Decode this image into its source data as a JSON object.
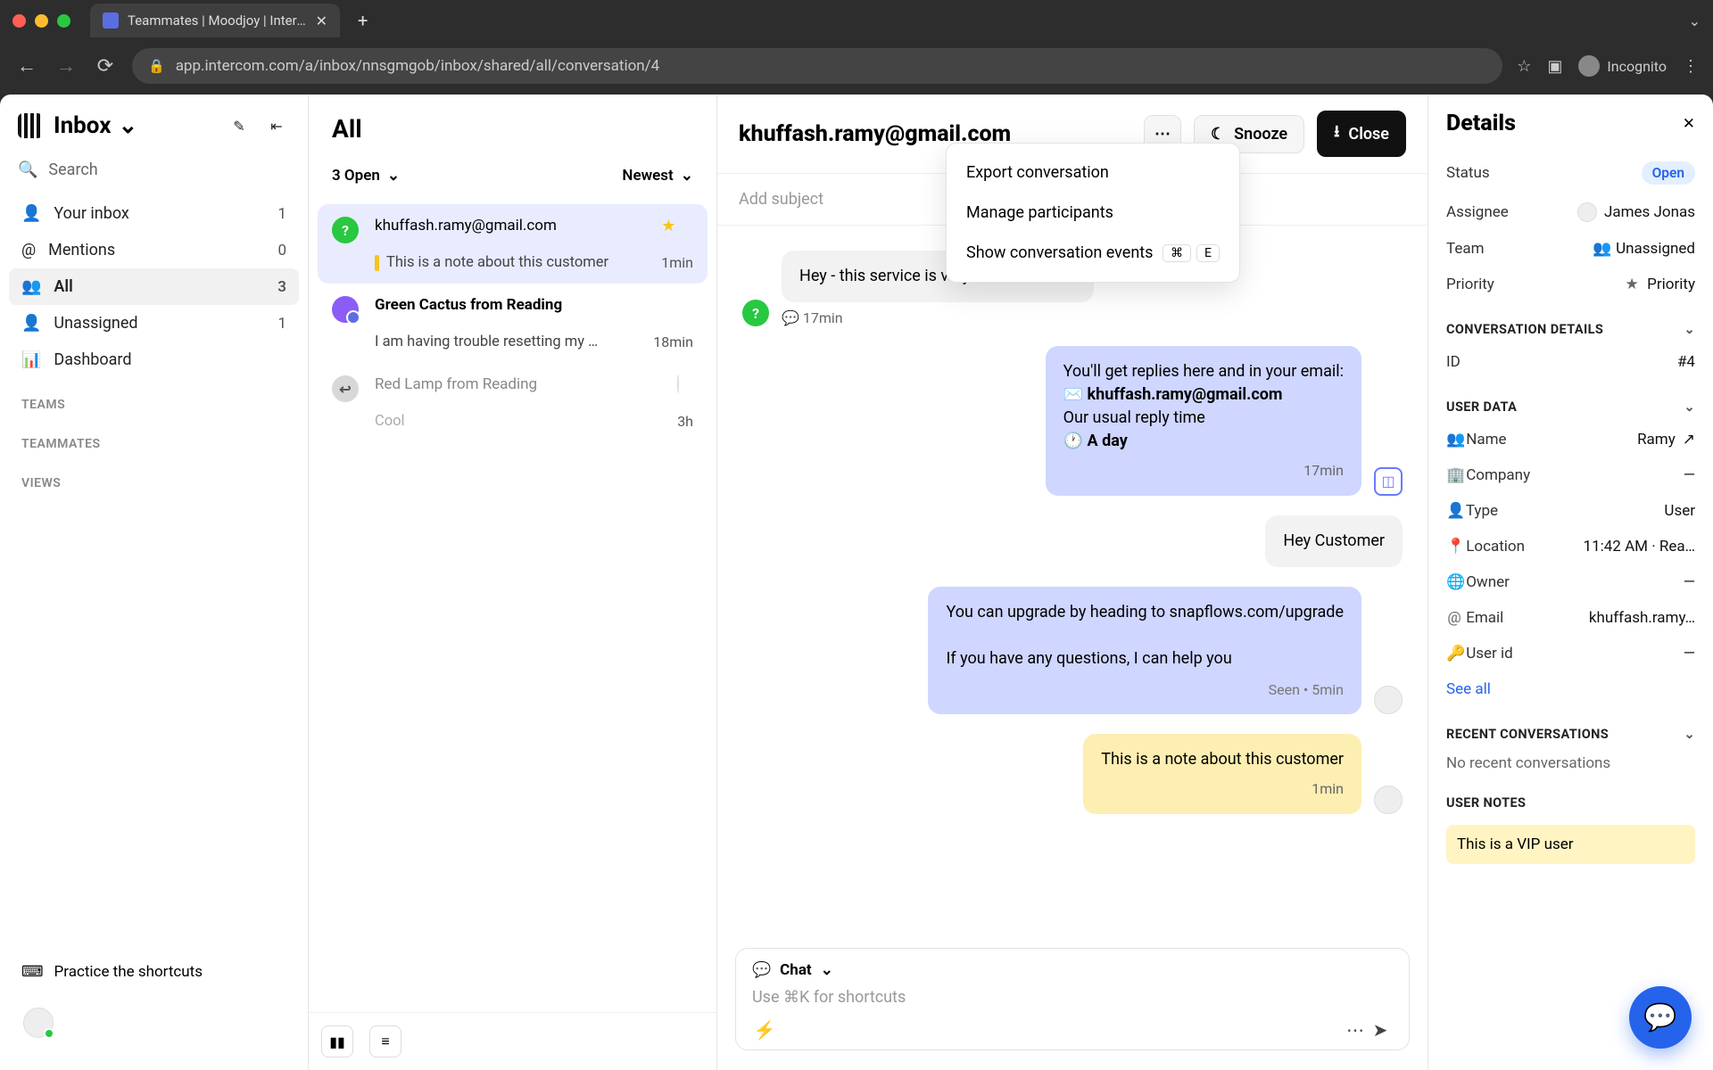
{
  "browser": {
    "tab_title": "Teammates | Moodjoy | Interco",
    "url": "app.intercom.com/a/inbox/nnsgmgob/inbox/shared/all/conversation/4",
    "incognito_label": "Incognito"
  },
  "sidebar": {
    "title": "Inbox",
    "search_label": "Search",
    "nav": [
      {
        "icon": "👤",
        "label": "Your inbox",
        "count": "1"
      },
      {
        "icon": "@",
        "label": "Mentions",
        "count": "0"
      },
      {
        "icon": "👥",
        "label": "All",
        "count": "3",
        "active": true
      },
      {
        "icon": "👤",
        "label": "Unassigned",
        "count": "1"
      },
      {
        "icon": "📊",
        "label": "Dashboard",
        "count": ""
      }
    ],
    "sections": [
      "TEAMS",
      "TEAMMATES",
      "VIEWS"
    ],
    "practice": "Practice the shortcuts"
  },
  "conv_list": {
    "title": "All",
    "open_filter": "3 Open",
    "sort": "Newest",
    "items": [
      {
        "badge": "?",
        "badge_cls": "badge-green",
        "title": "khuffash.ramy@gmail.com",
        "preview": "This is a note about this customer",
        "time": "1min",
        "starred": true,
        "note": true,
        "selected": true
      },
      {
        "badge": "",
        "badge_cls": "badge-purple",
        "title": "Green Cactus from Reading",
        "preview": "I am having trouble resetting my …",
        "time": "18min",
        "bold": true
      },
      {
        "badge": "↩",
        "badge_cls": "badge-grey",
        "title": "Red Lamp from Reading",
        "preview": "Cool",
        "time": "3h",
        "dim": true
      }
    ]
  },
  "conv": {
    "title": "khuffash.ramy@gmail.com",
    "snooze": "Snooze",
    "close": "Close",
    "subject_placeholder": "Add subject",
    "msgs": {
      "m1_text": "Hey - this service is very cool. How can",
      "m1_time": "17min",
      "sys_line1": "You'll get replies here and in your email:",
      "sys_email": "khuffash.ramy@gmail.com",
      "sys_line2": "Our usual reply time",
      "sys_line3": "A day",
      "sys_time": "17min",
      "m2_text": "Hey Customer",
      "m3_text1": "You can upgrade by heading to snapflows.com/upgrade",
      "m3_text2": "If you have any questions, I can help you",
      "m3_seen": "Seen • 5min",
      "note_text": "This is a note about this customer",
      "note_time": "1min"
    },
    "composer": {
      "mode": "Chat",
      "placeholder": "Use ⌘K for shortcuts"
    },
    "menu": {
      "export": "Export conversation",
      "manage": "Manage participants",
      "show_events": "Show conversation events",
      "kbd1": "⌘",
      "kbd2": "E"
    }
  },
  "details": {
    "title": "Details",
    "status_label": "Status",
    "status_value": "Open",
    "assignee_label": "Assignee",
    "assignee_value": "James Jonas",
    "team_label": "Team",
    "team_value": "Unassigned",
    "priority_label": "Priority",
    "priority_value": "Priority",
    "section_conversation": "CONVERSATION DETAILS",
    "id_label": "ID",
    "id_value": "#4",
    "section_user": "USER DATA",
    "user": {
      "name_label": "Name",
      "name_value": "Ramy",
      "company_label": "Company",
      "company_value": "—",
      "type_label": "Type",
      "type_value": "User",
      "location_label": "Location",
      "location_value": "11:42 AM · Rea…",
      "owner_label": "Owner",
      "owner_value": "—",
      "email_label": "Email",
      "email_value": "khuffash.ramy…",
      "userid_label": "User id",
      "userid_value": "—"
    },
    "see_all": "See all",
    "section_recent": "RECENT CONVERSATIONS",
    "recent_empty": "No recent conversations",
    "section_notes": "USER NOTES",
    "note": "This is a VIP user"
  }
}
